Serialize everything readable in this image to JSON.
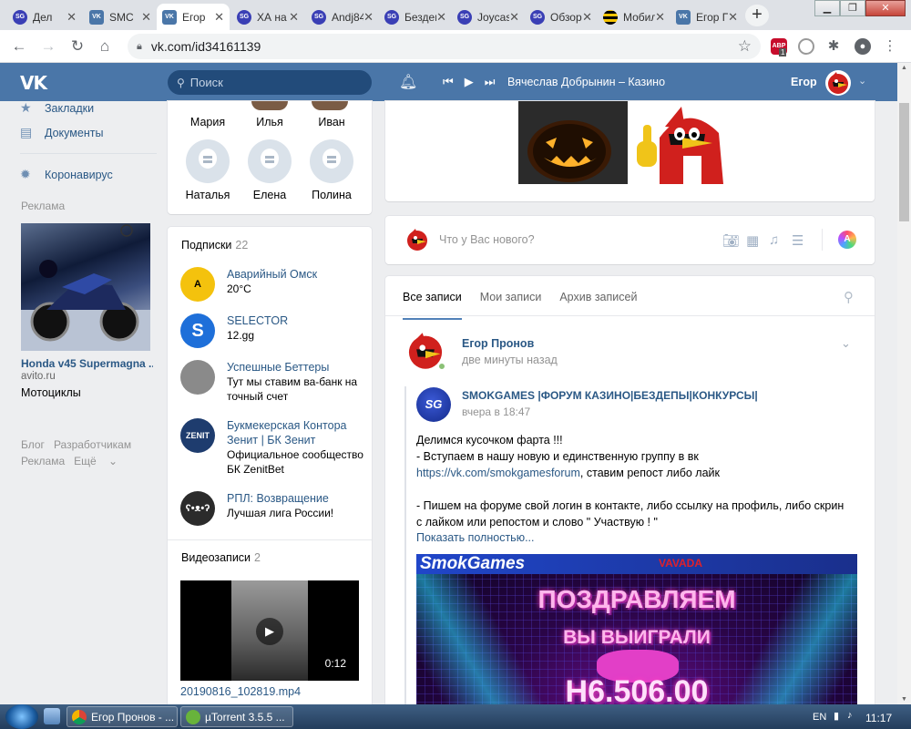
{
  "browser": {
    "tabs": [
      {
        "label": "Дел",
        "icon": "sg"
      },
      {
        "label": "SMC",
        "icon": "vk"
      },
      {
        "label": "Егор",
        "icon": "vk",
        "active": true
      },
      {
        "label": "ХА на С",
        "icon": "sg"
      },
      {
        "label": "Andj845",
        "icon": "sg"
      },
      {
        "label": "Бездеп",
        "icon": "sg"
      },
      {
        "label": "Joycasino",
        "icon": "sg"
      },
      {
        "label": "Обзор",
        "icon": "sg"
      },
      {
        "label": "Мобилн",
        "icon": "bee"
      },
      {
        "label": "Егор Пр",
        "icon": "vk"
      }
    ],
    "url": "vk.com/id34161139",
    "extension_badge": "1"
  },
  "vk_header": {
    "logo": "VK",
    "search_placeholder": "Поиск",
    "now_playing": "Вячеслав Добрынин – Казино",
    "user_name": "Егор"
  },
  "left_nav": {
    "items": [
      {
        "label": "Закладки",
        "icon": "star-icon"
      },
      {
        "label": "Документы",
        "icon": "document-icon"
      },
      {
        "label": "Коронавирус",
        "icon": "virus-icon"
      }
    ],
    "ad": {
      "label": "Реклама",
      "title": "Honda v45 Supermagna ...",
      "domain": "avito.ru",
      "category": "Мотоциклы"
    },
    "footer_links": [
      "Блог",
      "Разработчикам",
      "Реклама",
      "Ещё"
    ]
  },
  "friends": {
    "row1": [
      "Мария",
      "Илья",
      "Иван"
    ],
    "row2": [
      "Наталья",
      "Елена",
      "Полина"
    ]
  },
  "subscriptions": {
    "title": "Подписки",
    "count": "22",
    "items": [
      {
        "name": "Аварийный Омск",
        "desc": "20°С",
        "color": "#f4c20d"
      },
      {
        "name": "SELECTOR",
        "desc": "12.gg",
        "color": "#1e6fd9"
      },
      {
        "name": "Успешные Беттеры",
        "desc": "Тут мы ставим ва-банк на точный счет",
        "color": "#8a8a8a"
      },
      {
        "name": "Букмекерская Контора Зенит | БК Зенит",
        "desc": "Официальное сообщество БК ZenitBet",
        "color": "#1e3c6e"
      },
      {
        "name": "РПЛ: Возвращение",
        "desc": "Лучшая лига России!",
        "color": "#2b2b2b"
      }
    ]
  },
  "videos": {
    "title": "Видеозаписи",
    "count": "2",
    "item": {
      "duration": "0:12",
      "title": "20190816_102819.mp4"
    }
  },
  "composer": {
    "placeholder": "Что у Вас нового?"
  },
  "wall_tabs": [
    "Все записи",
    "Мои записи",
    "Архив записей"
  ],
  "post": {
    "author": "Егор Пронов",
    "time": "две минуты назад",
    "repost": {
      "group": "SMOKGAMES |ФОРУМ КАЗИНО|БЕЗДЕПЫ|КОНКУРСЫ|",
      "time": "вчера в 18:47",
      "avatar_text": "SG",
      "text_line1": "Делимся кусочком фарта !!!",
      "text_line2": "- Вступаем в нашу новую и единственную группу в вк",
      "link": "https://vk.com/smokgamesforum",
      "text_after_link": ", ставим репост либо лайк",
      "text_line4": "- Пишем на форуме свой логин в контакте, либо ссылку на профиль, либо скрин",
      "text_line5": "с лайком или репостом и слово \" Участвую ! \"",
      "show_more": "Показать полностью..."
    },
    "banner": {
      "brand": "SmokGames",
      "sponsor": "VAVADA",
      "headline": "ПОЗДРАВЛЯЕМ",
      "subheadline": "ВЫ ВЫИГРАЛИ",
      "amount": "Н6.506.00"
    }
  },
  "taskbar": {
    "tasks": [
      {
        "label": "Егор Пронов - ...",
        "color": "#e7b12c"
      },
      {
        "label": "µTorrent 3.5.5 ...",
        "color": "#68b33b"
      }
    ],
    "lang": "EN",
    "time": "11:17"
  }
}
